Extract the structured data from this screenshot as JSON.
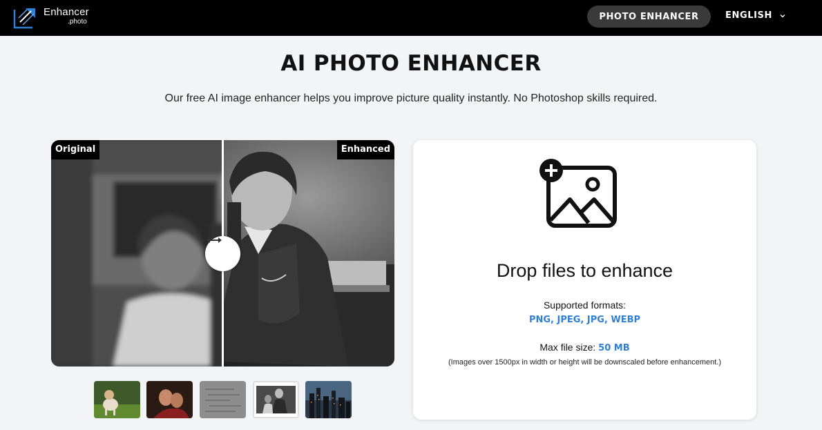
{
  "header": {
    "logo_name": "Enhancer",
    "logo_sub": ".photo",
    "nav_button": "PHOTO ENHANCER",
    "language": "ENGLISH"
  },
  "hero": {
    "title": "AI PHOTO ENHANCER",
    "subtitle": "Our free AI image enhancer helps you improve picture quality instantly. No Photoshop skills required."
  },
  "compare": {
    "left_tag": "Original",
    "right_tag": "Enhanced",
    "handle_icon": "horizontal-arrows-icon"
  },
  "thumbnails": [
    {
      "name": "thumb-dog",
      "active": false
    },
    {
      "name": "thumb-portrait",
      "active": false
    },
    {
      "name": "thumb-document",
      "active": false
    },
    {
      "name": "thumb-old-photo",
      "active": true
    },
    {
      "name": "thumb-city",
      "active": false
    }
  ],
  "dropzone": {
    "icon": "add-image-icon",
    "title": "Drop files to enhance",
    "formats_label": "Supported formats:",
    "formats": "PNG, JPEG, JPG, WEBP",
    "max_label": "Max file size:",
    "max_value": "50 MB",
    "note": "(Images over 1500px in width or height will be downscaled before enhancement.)"
  },
  "colors": {
    "accent": "#2f7fd6",
    "header_bg": "#000000",
    "page_bg": "#f3f4f6"
  }
}
